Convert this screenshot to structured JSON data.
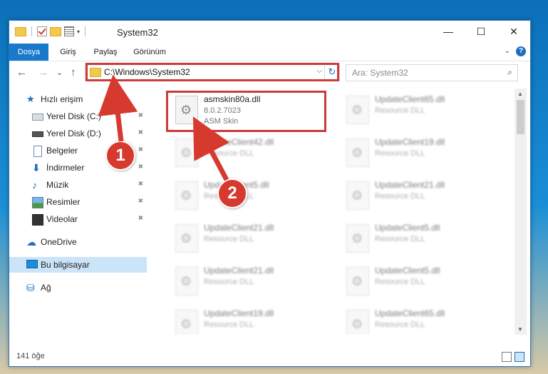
{
  "window": {
    "title": "System32",
    "buttons": [
      "—",
      "☐",
      "✕"
    ]
  },
  "ribbon": {
    "tabs": [
      "Dosya",
      "Giriş",
      "Paylaş",
      "Görünüm"
    ],
    "active_tab": "Dosya",
    "help": "?"
  },
  "address_bar": {
    "path": "C:\\Windows\\System32",
    "refresh_icon": "↻",
    "dropdown_icon": "⌵"
  },
  "search": {
    "placeholder": "Ara: System32"
  },
  "navigation": {
    "back": "←",
    "forward": "→",
    "recent": "⌄",
    "up": "↑"
  },
  "sidebar": {
    "quick_access": "Hızlı erişim",
    "pinned_items": [
      {
        "label": "Yerel Disk (C:)",
        "icon": "disk-icon"
      },
      {
        "label": "Yerel Disk (D:)",
        "icon": "disk-icon"
      },
      {
        "label": "Belgeler",
        "icon": "document-icon"
      },
      {
        "label": "İndirmeler",
        "icon": "download-icon"
      },
      {
        "label": "Müzik",
        "icon": "music-icon"
      },
      {
        "label": "Resimler",
        "icon": "picture-icon"
      },
      {
        "label": "Videolar",
        "icon": "video-icon"
      }
    ],
    "onedrive": "OneDrive",
    "this_pc": "Bu bilgisayar",
    "network": "Ağ"
  },
  "files": [
    {
      "name": "asmskin80a.dll",
      "version": "8.0.2.7023",
      "description": "ASM Skin",
      "highlighted": true
    },
    {
      "name": "UpdateClient65.dll",
      "version": "",
      "description": "Resource DLL"
    },
    {
      "name": "UpdateClient42.dll",
      "version": "",
      "description": "Resource DLL"
    },
    {
      "name": "UpdateClient19.dll",
      "version": "",
      "description": "Resource DLL"
    },
    {
      "name": "UpdateClient5.dll",
      "version": "",
      "description": "Resource DLL"
    },
    {
      "name": "UpdateClient21.dll",
      "version": "",
      "description": "Resource DLL"
    },
    {
      "name": "UpdateClient21.dll",
      "version": "",
      "description": "Resource DLL"
    },
    {
      "name": "UpdateClient5.dll",
      "version": "",
      "description": "Resource DLL"
    },
    {
      "name": "UpdateClient21.dll",
      "version": "",
      "description": "Resource DLL"
    },
    {
      "name": "UpdateClient5.dll",
      "version": "",
      "description": "Resource DLL"
    },
    {
      "name": "UpdateClient19.dll",
      "version": "",
      "description": "Resource DLL"
    },
    {
      "name": "UpdateClient65.dll",
      "version": "",
      "description": "Resource DLL"
    }
  ],
  "status": {
    "item_count": "141 öğe"
  },
  "annotations": {
    "step1": "1",
    "step2": "2",
    "highlight_color": "#cc3a3a"
  }
}
